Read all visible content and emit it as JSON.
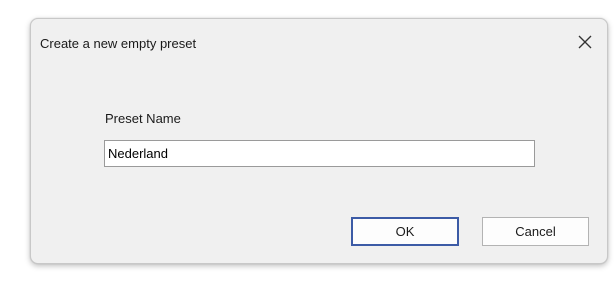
{
  "dialog": {
    "title": "Create a new empty preset",
    "close_icon": "close-icon",
    "field_label": "Preset Name",
    "preset_name_value": "Nederland",
    "ok_label": "OK",
    "cancel_label": "Cancel"
  },
  "colors": {
    "dialog_background": "#f0f0f0",
    "default_button_border": "#3c5ba6",
    "input_border": "#9a9a9a"
  }
}
